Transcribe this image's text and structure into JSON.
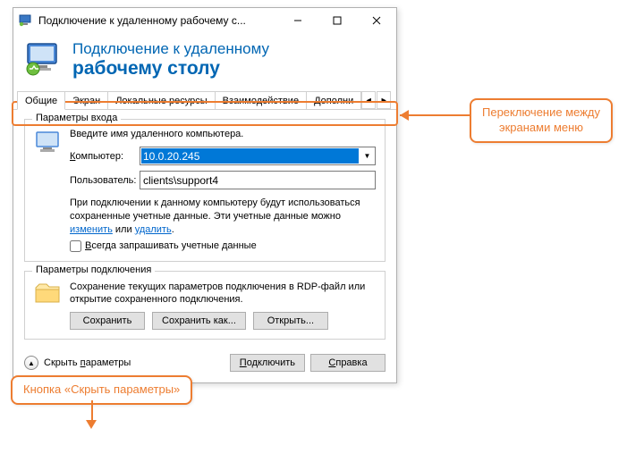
{
  "window": {
    "title": "Подключение к удаленному рабочему с..."
  },
  "header": {
    "line1": "Подключение к удаленному",
    "line2": "рабочему столу"
  },
  "tabs": {
    "t0": "Общие",
    "t1": "Экран",
    "t2": "Локальные ресурсы",
    "t3": "Взаимодействие",
    "t4": "Дополни"
  },
  "login": {
    "group_title": "Параметры входа",
    "instruction": "Введите имя удаленного компьютера.",
    "computer_label_pre": "",
    "computer_label_u": "К",
    "computer_label_post": "омпьютер:",
    "computer_value": "10.0.20.245",
    "user_label": "Пользователь:",
    "user_value": "clients\\support4",
    "note_part1": "При подключении к данному компьютеру будут использоваться сохраненные учетные данные.  Эти учетные данные можно ",
    "note_link1": "изменить",
    "note_mid": " или ",
    "note_link2": "удалить",
    "note_end": ".",
    "checkbox_u": "В",
    "checkbox_post": "сегда запрашивать учетные данные"
  },
  "conn": {
    "group_title": "Параметры подключения",
    "desc": "Сохранение текущих параметров подключения в RDP-файл или открытие сохраненного подключения.",
    "save": "Сохранить",
    "save_as": "Сохранить как...",
    "open": "Открыть..."
  },
  "footer": {
    "hide_pre": "Скрыть ",
    "hide_u": "п",
    "hide_post": "араметры",
    "connect_u": "П",
    "connect_post": "одключить",
    "help_u": "С",
    "help_post": "правка"
  },
  "annotations": {
    "tabs_callout": "Переключение между экранами меню",
    "hide_callout": "Кнопка «Скрыть параметры»"
  }
}
